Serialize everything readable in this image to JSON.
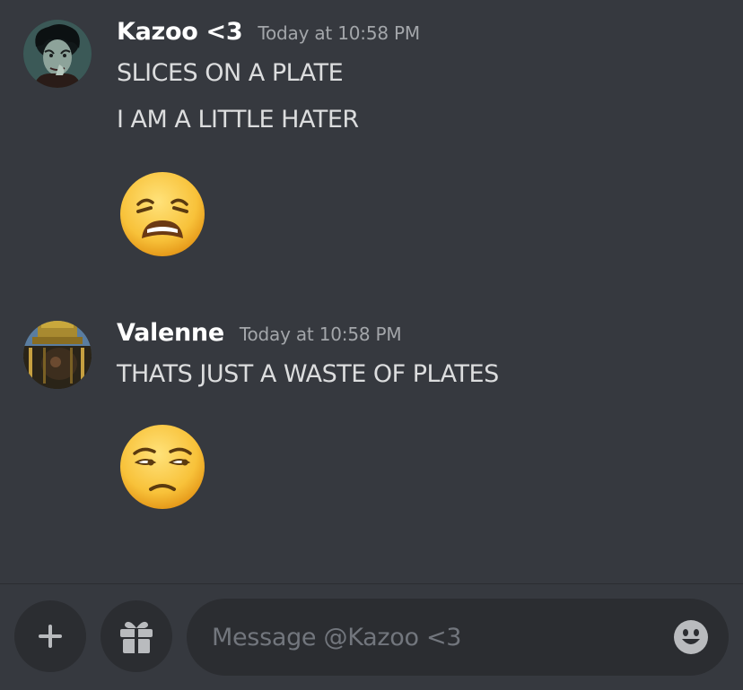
{
  "messages": [
    {
      "author": "Kazoo <3",
      "timestamp": "Today at 10:58 PM",
      "lines": [
        "SLICES ON A PLATE",
        "I AM A LITTLE HATER"
      ],
      "emoji": "weary-face-emoji"
    },
    {
      "author": "Valenne",
      "timestamp": "Today at 10:58 PM",
      "lines": [
        "THATS JUST A WASTE OF PLATES"
      ],
      "emoji": "unamused-face-emoji"
    }
  ],
  "composer": {
    "placeholder": "Message @Kazoo <3",
    "add_icon": "plus-icon",
    "gift_icon": "gift-icon",
    "emoji_icon": "smiley-icon"
  },
  "colors": {
    "background": "#36393f",
    "button_bg": "#2b2d31",
    "username": "#ffffff",
    "timestamp": "#a3a6aa",
    "text": "#dcddde",
    "placeholder": "#72767d"
  }
}
